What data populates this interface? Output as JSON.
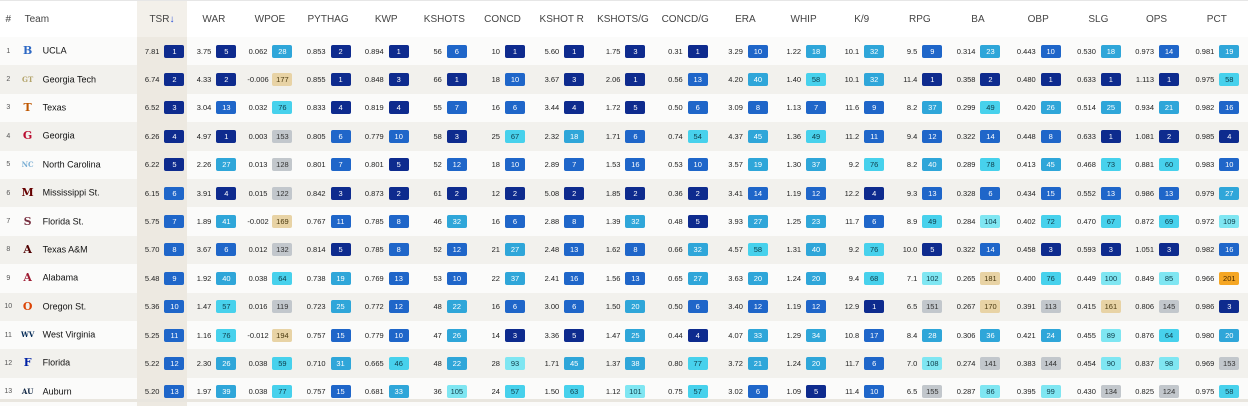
{
  "columns": [
    {
      "key": "rank",
      "label": "#"
    },
    {
      "key": "team",
      "label": "Team"
    },
    {
      "key": "tsr",
      "label": "TSR",
      "sort_icon": "sort-down-arrow-icon"
    },
    {
      "key": "war",
      "label": "WAR"
    },
    {
      "key": "wpoe",
      "label": "WPOE"
    },
    {
      "key": "pythag",
      "label": "PYTHAG"
    },
    {
      "key": "kwp",
      "label": "KWP"
    },
    {
      "key": "kshots",
      "label": "KSHOTS"
    },
    {
      "key": "concd",
      "label": "CONCD"
    },
    {
      "key": "kshotr",
      "label": "KSHOT R"
    },
    {
      "key": "kshotsg",
      "label": "KSHOTS/G"
    },
    {
      "key": "concdg",
      "label": "CONCD/G"
    },
    {
      "key": "era",
      "label": "ERA"
    },
    {
      "key": "whip",
      "label": "WHIP"
    },
    {
      "key": "k9",
      "label": "K/9"
    },
    {
      "key": "rpg",
      "label": "RPG"
    },
    {
      "key": "ba",
      "label": "BA"
    },
    {
      "key": "obp",
      "label": "OBP"
    },
    {
      "key": "slg",
      "label": "SLG"
    },
    {
      "key": "ops",
      "label": "OPS"
    },
    {
      "key": "pct",
      "label": "PCT"
    }
  ],
  "logos": {
    "UCLA": {
      "icon": "ucla-bruins-logo-icon",
      "glyph": "B",
      "color": "#2d68c4"
    },
    "Georgia Tech": {
      "icon": "georgia-tech-logo-icon",
      "glyph": "GT",
      "color": "#b3a369"
    },
    "Texas": {
      "icon": "texas-longhorn-logo-icon",
      "glyph": "T",
      "color": "#bf5700"
    },
    "Georgia": {
      "icon": "georgia-bulldogs-logo-icon",
      "glyph": "G",
      "color": "#ba0c2f"
    },
    "North Carolina": {
      "icon": "north-carolina-logo-icon",
      "glyph": "NC",
      "color": "#7bafd4"
    },
    "Mississippi St.": {
      "icon": "mississippi-state-logo-icon",
      "glyph": "M",
      "color": "#660000"
    },
    "Florida St.": {
      "icon": "florida-state-logo-icon",
      "glyph": "S",
      "color": "#782f40"
    },
    "Texas A&M": {
      "icon": "texas-am-logo-icon",
      "glyph": "A",
      "color": "#500000"
    },
    "Alabama": {
      "icon": "alabama-logo-icon",
      "glyph": "A",
      "color": "#9e1b32"
    },
    "Oregon St.": {
      "icon": "oregon-state-beaver-logo-icon",
      "glyph": "O",
      "color": "#dc4405"
    },
    "West Virginia": {
      "icon": "west-virginia-logo-icon",
      "glyph": "WV",
      "color": "#002855"
    },
    "Florida": {
      "icon": "florida-gators-logo-icon",
      "glyph": "F",
      "color": "#0021a5"
    },
    "Auburn": {
      "icon": "auburn-logo-icon",
      "glyph": "AU",
      "color": "#0c2340"
    }
  },
  "rows": [
    {
      "rank": "1",
      "team": "UCLA",
      "cells": [
        [
          "7.81",
          "1"
        ],
        [
          "3.75",
          "5"
        ],
        [
          "0.062",
          "28"
        ],
        [
          "0.853",
          "2"
        ],
        [
          "0.894",
          "1"
        ],
        [
          "56",
          "6"
        ],
        [
          "10",
          "1"
        ],
        [
          "5.60",
          "1"
        ],
        [
          "1.75",
          "3"
        ],
        [
          "0.31",
          "1"
        ],
        [
          "3.29",
          "10"
        ],
        [
          "1.22",
          "18"
        ],
        [
          "10.1",
          "32"
        ],
        [
          "9.5",
          "9"
        ],
        [
          "0.314",
          "23"
        ],
        [
          "0.443",
          "10"
        ],
        [
          "0.530",
          "18"
        ],
        [
          "0.973",
          "14"
        ],
        [
          "0.981",
          "19"
        ]
      ]
    },
    {
      "rank": "2",
      "team": "Georgia Tech",
      "cells": [
        [
          "6.74",
          "2"
        ],
        [
          "4.33",
          "2"
        ],
        [
          "-0.006",
          "177"
        ],
        [
          "0.855",
          "1"
        ],
        [
          "0.848",
          "3"
        ],
        [
          "66",
          "1"
        ],
        [
          "18",
          "10"
        ],
        [
          "3.67",
          "3"
        ],
        [
          "2.06",
          "1"
        ],
        [
          "0.56",
          "13"
        ],
        [
          "4.20",
          "40"
        ],
        [
          "1.40",
          "58"
        ],
        [
          "10.1",
          "32"
        ],
        [
          "11.4",
          "1"
        ],
        [
          "0.358",
          "2"
        ],
        [
          "0.480",
          "1"
        ],
        [
          "0.633",
          "1"
        ],
        [
          "1.113",
          "1"
        ],
        [
          "0.975",
          "58"
        ]
      ]
    },
    {
      "rank": "3",
      "team": "Texas",
      "cells": [
        [
          "6.52",
          "3"
        ],
        [
          "3.04",
          "13"
        ],
        [
          "0.032",
          "76"
        ],
        [
          "0.833",
          "4"
        ],
        [
          "0.819",
          "4"
        ],
        [
          "55",
          "7"
        ],
        [
          "16",
          "6"
        ],
        [
          "3.44",
          "4"
        ],
        [
          "1.72",
          "5"
        ],
        [
          "0.50",
          "6"
        ],
        [
          "3.09",
          "8"
        ],
        [
          "1.13",
          "7"
        ],
        [
          "11.6",
          "9"
        ],
        [
          "8.2",
          "37"
        ],
        [
          "0.299",
          "49"
        ],
        [
          "0.420",
          "26"
        ],
        [
          "0.514",
          "25"
        ],
        [
          "0.934",
          "21"
        ],
        [
          "0.982",
          "16"
        ]
      ]
    },
    {
      "rank": "4",
      "team": "Georgia",
      "cells": [
        [
          "6.26",
          "4"
        ],
        [
          "4.97",
          "1"
        ],
        [
          "0.003",
          "153"
        ],
        [
          "0.805",
          "6"
        ],
        [
          "0.779",
          "10"
        ],
        [
          "58",
          "3"
        ],
        [
          "25",
          "67"
        ],
        [
          "2.32",
          "18"
        ],
        [
          "1.71",
          "6"
        ],
        [
          "0.74",
          "54"
        ],
        [
          "4.37",
          "45"
        ],
        [
          "1.36",
          "49"
        ],
        [
          "11.2",
          "11"
        ],
        [
          "9.4",
          "12"
        ],
        [
          "0.322",
          "14"
        ],
        [
          "0.448",
          "8"
        ],
        [
          "0.633",
          "1"
        ],
        [
          "1.081",
          "2"
        ],
        [
          "0.985",
          "4"
        ]
      ]
    },
    {
      "rank": "5",
      "team": "North Carolina",
      "cells": [
        [
          "6.22",
          "5"
        ],
        [
          "2.26",
          "27"
        ],
        [
          "0.013",
          "128"
        ],
        [
          "0.801",
          "7"
        ],
        [
          "0.801",
          "5"
        ],
        [
          "52",
          "12"
        ],
        [
          "18",
          "10"
        ],
        [
          "2.89",
          "7"
        ],
        [
          "1.53",
          "16"
        ],
        [
          "0.53",
          "10"
        ],
        [
          "3.57",
          "19"
        ],
        [
          "1.30",
          "37"
        ],
        [
          "9.2",
          "76"
        ],
        [
          "8.2",
          "40"
        ],
        [
          "0.289",
          "78"
        ],
        [
          "0.413",
          "45"
        ],
        [
          "0.468",
          "73"
        ],
        [
          "0.881",
          "60"
        ],
        [
          "0.983",
          "10"
        ]
      ]
    },
    {
      "rank": "6",
      "team": "Mississippi St.",
      "cells": [
        [
          "6.15",
          "6"
        ],
        [
          "3.91",
          "4"
        ],
        [
          "0.015",
          "122"
        ],
        [
          "0.842",
          "3"
        ],
        [
          "0.873",
          "2"
        ],
        [
          "61",
          "2"
        ],
        [
          "12",
          "2"
        ],
        [
          "5.08",
          "2"
        ],
        [
          "1.85",
          "2"
        ],
        [
          "0.36",
          "2"
        ],
        [
          "3.41",
          "14"
        ],
        [
          "1.19",
          "12"
        ],
        [
          "12.2",
          "4"
        ],
        [
          "9.3",
          "13"
        ],
        [
          "0.328",
          "6"
        ],
        [
          "0.434",
          "15"
        ],
        [
          "0.552",
          "13"
        ],
        [
          "0.986",
          "13"
        ],
        [
          "0.979",
          "27"
        ]
      ]
    },
    {
      "rank": "7",
      "team": "Florida St.",
      "cells": [
        [
          "5.75",
          "7"
        ],
        [
          "1.89",
          "41"
        ],
        [
          "-0.002",
          "169"
        ],
        [
          "0.767",
          "11"
        ],
        [
          "0.785",
          "8"
        ],
        [
          "46",
          "32"
        ],
        [
          "16",
          "6"
        ],
        [
          "2.88",
          "8"
        ],
        [
          "1.39",
          "32"
        ],
        [
          "0.48",
          "5"
        ],
        [
          "3.93",
          "27"
        ],
        [
          "1.25",
          "23"
        ],
        [
          "11.7",
          "6"
        ],
        [
          "8.9",
          "49"
        ],
        [
          "0.284",
          "104"
        ],
        [
          "0.402",
          "72"
        ],
        [
          "0.470",
          "67"
        ],
        [
          "0.872",
          "69"
        ],
        [
          "0.972",
          "109"
        ]
      ]
    },
    {
      "rank": "8",
      "team": "Texas A&M",
      "cells": [
        [
          "5.70",
          "8"
        ],
        [
          "3.67",
          "6"
        ],
        [
          "0.012",
          "132"
        ],
        [
          "0.814",
          "5"
        ],
        [
          "0.785",
          "8"
        ],
        [
          "52",
          "12"
        ],
        [
          "21",
          "27"
        ],
        [
          "2.48",
          "13"
        ],
        [
          "1.62",
          "8"
        ],
        [
          "0.66",
          "32"
        ],
        [
          "4.57",
          "58"
        ],
        [
          "1.31",
          "40"
        ],
        [
          "9.2",
          "76"
        ],
        [
          "10.0",
          "5"
        ],
        [
          "0.322",
          "14"
        ],
        [
          "0.458",
          "3"
        ],
        [
          "0.593",
          "3"
        ],
        [
          "1.051",
          "3"
        ],
        [
          "0.982",
          "16"
        ]
      ]
    },
    {
      "rank": "9",
      "team": "Alabama",
      "cells": [
        [
          "5.48",
          "9"
        ],
        [
          "1.92",
          "40"
        ],
        [
          "0.038",
          "64"
        ],
        [
          "0.738",
          "19"
        ],
        [
          "0.769",
          "13"
        ],
        [
          "53",
          "10"
        ],
        [
          "22",
          "37"
        ],
        [
          "2.41",
          "16"
        ],
        [
          "1.56",
          "13"
        ],
        [
          "0.65",
          "27"
        ],
        [
          "3.63",
          "20"
        ],
        [
          "1.24",
          "20"
        ],
        [
          "9.4",
          "68"
        ],
        [
          "7.1",
          "102"
        ],
        [
          "0.265",
          "181"
        ],
        [
          "0.400",
          "76"
        ],
        [
          "0.449",
          "100"
        ],
        [
          "0.849",
          "85"
        ],
        [
          "0.966",
          "201"
        ]
      ]
    },
    {
      "rank": "10",
      "team": "Oregon St.",
      "cells": [
        [
          "5.36",
          "10"
        ],
        [
          "1.47",
          "57"
        ],
        [
          "0.016",
          "119"
        ],
        [
          "0.723",
          "25"
        ],
        [
          "0.772",
          "12"
        ],
        [
          "48",
          "22"
        ],
        [
          "16",
          "6"
        ],
        [
          "3.00",
          "6"
        ],
        [
          "1.50",
          "20"
        ],
        [
          "0.50",
          "6"
        ],
        [
          "3.40",
          "12"
        ],
        [
          "1.19",
          "12"
        ],
        [
          "12.9",
          "1"
        ],
        [
          "6.5",
          "151"
        ],
        [
          "0.267",
          "170"
        ],
        [
          "0.391",
          "113"
        ],
        [
          "0.415",
          "161"
        ],
        [
          "0.806",
          "145"
        ],
        [
          "0.986",
          "3"
        ]
      ]
    },
    {
      "rank": "11",
      "team": "West Virginia",
      "cells": [
        [
          "5.25",
          "11"
        ],
        [
          "1.16",
          "76"
        ],
        [
          "-0.012",
          "194"
        ],
        [
          "0.757",
          "15"
        ],
        [
          "0.779",
          "10"
        ],
        [
          "47",
          "26"
        ],
        [
          "14",
          "3"
        ],
        [
          "3.36",
          "5"
        ],
        [
          "1.47",
          "25"
        ],
        [
          "0.44",
          "4"
        ],
        [
          "4.07",
          "33"
        ],
        [
          "1.29",
          "34"
        ],
        [
          "10.8",
          "17"
        ],
        [
          "8.4",
          "28"
        ],
        [
          "0.306",
          "36"
        ],
        [
          "0.421",
          "24"
        ],
        [
          "0.455",
          "89"
        ],
        [
          "0.876",
          "64"
        ],
        [
          "0.980",
          "20"
        ]
      ]
    },
    {
      "rank": "12",
      "team": "Florida",
      "cells": [
        [
          "5.22",
          "12"
        ],
        [
          "2.30",
          "26"
        ],
        [
          "0.038",
          "59"
        ],
        [
          "0.710",
          "31"
        ],
        [
          "0.665",
          "46"
        ],
        [
          "48",
          "22"
        ],
        [
          "28",
          "93"
        ],
        [
          "1.71",
          "45"
        ],
        [
          "1.37",
          "38"
        ],
        [
          "0.80",
          "77"
        ],
        [
          "3.72",
          "21"
        ],
        [
          "1.24",
          "20"
        ],
        [
          "11.7",
          "6"
        ],
        [
          "7.0",
          "108"
        ],
        [
          "0.274",
          "141"
        ],
        [
          "0.383",
          "144"
        ],
        [
          "0.454",
          "90"
        ],
        [
          "0.837",
          "98"
        ],
        [
          "0.969",
          "153"
        ]
      ]
    },
    {
      "rank": "13",
      "team": "Auburn",
      "cells": [
        [
          "5.20",
          "13"
        ],
        [
          "1.97",
          "39"
        ],
        [
          "0.038",
          "77"
        ],
        [
          "0.757",
          "15"
        ],
        [
          "0.681",
          "33"
        ],
        [
          "36",
          "105"
        ],
        [
          "24",
          "57"
        ],
        [
          "1.50",
          "63"
        ],
        [
          "1.12",
          "101"
        ],
        [
          "0.75",
          "57"
        ],
        [
          "3.02",
          "6"
        ],
        [
          "1.09",
          "5"
        ],
        [
          "11.4",
          "10"
        ],
        [
          "6.5",
          "155"
        ],
        [
          "0.287",
          "86"
        ],
        [
          "0.395",
          "99"
        ],
        [
          "0.430",
          "134"
        ],
        [
          "0.825",
          "124"
        ],
        [
          "0.975",
          "58"
        ]
      ]
    }
  ],
  "color_scale": [
    {
      "max": 5,
      "bg": "#0e2b8e",
      "fg": "#ffffff"
    },
    {
      "max": 17,
      "bg": "#1f66c9",
      "fg": "#ffffff"
    },
    {
      "max": 45,
      "bg": "#2fa6d9",
      "fg": "#ffffff"
    },
    {
      "max": 80,
      "bg": "#47d1ec",
      "fg": "#0f3d4a"
    },
    {
      "max": 110,
      "bg": "#7fe6f2",
      "fg": "#0f3d4a"
    },
    {
      "max": 160,
      "bg": "#c2c7cc",
      "fg": "#333333"
    },
    {
      "max": 200,
      "bg": "#e8d3a5",
      "fg": "#4a3a10"
    },
    {
      "max": 9999,
      "bg": "#f5a623",
      "fg": "#4a2a00"
    }
  ]
}
